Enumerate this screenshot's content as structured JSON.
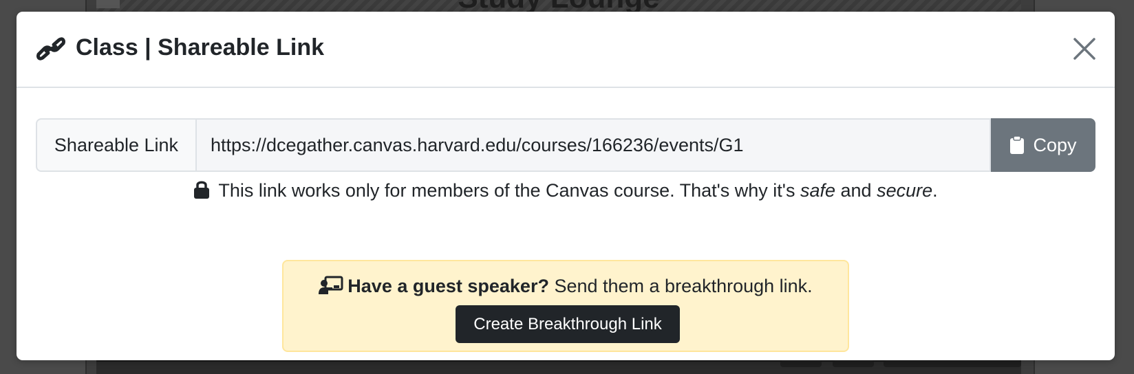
{
  "background": {
    "title": "Study Lounge"
  },
  "modal": {
    "title": "Class | Shareable Link",
    "title_icon": "link-icon",
    "close_icon": "close-icon"
  },
  "share": {
    "label": "Shareable Link",
    "url": "https://dcegather.canvas.harvard.edu/courses/166236/events/G1",
    "copy_label": "Copy",
    "copy_icon": "clipboard-icon"
  },
  "note": {
    "icon": "lock-icon",
    "prefix": "This link works only for members of the Canvas course. That's why it's ",
    "em1": "safe",
    "mid": " and ",
    "em2": "secure",
    "suffix": "."
  },
  "guest": {
    "icon": "speaker-icon",
    "strong": "Have a guest speaker?",
    "text": " Send them a breakthrough link.",
    "button_label": "Create Breakthrough Link"
  },
  "colors": {
    "modal_bg": "#ffffff",
    "copy_button": "#6c757d",
    "guest_bg": "#fff3cd",
    "create_button": "#212529"
  }
}
